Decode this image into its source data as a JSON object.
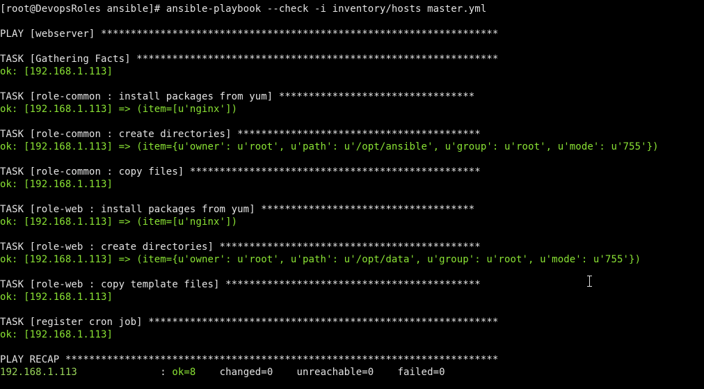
{
  "prompt": "[root@DevopsRoles ansible]# ",
  "command": "ansible-playbook --check -i inventory/hosts master.yml",
  "blank": "",
  "play_header": "PLAY [webserver] *******************************************************************",
  "tasks": [
    {
      "header": "TASK [Gathering Facts] *************************************************************",
      "result": "ok: [192.168.1.113]"
    },
    {
      "header": "TASK [role-common : install packages from yum] *********************************",
      "result": "ok: [192.168.1.113] => (item=[u'nginx'])"
    },
    {
      "header": "TASK [role-common : create directories] *****************************************",
      "result": "ok: [192.168.1.113] => (item={u'owner': u'root', u'path': u'/opt/ansible', u'group': u'root', u'mode': u'755'})"
    },
    {
      "header": "TASK [role-common : copy files] *************************************************",
      "result": "ok: [192.168.1.113]"
    },
    {
      "header": "TASK [role-web : install packages from yum] ************************************",
      "result": "ok: [192.168.1.113] => (item=[u'nginx'])"
    },
    {
      "header": "TASK [role-web : create directories] ********************************************",
      "result": "ok: [192.168.1.113] => (item={u'owner': u'root', u'path': u'/opt/data', u'group': u'root', u'mode': u'755'})"
    },
    {
      "header": "TASK [role-web : copy template files] *******************************************",
      "result": "ok: [192.168.1.113]"
    },
    {
      "header": "TASK [register cron job] ***********************************************************",
      "result": "ok: [192.168.1.113]"
    }
  ],
  "recap": {
    "header": "PLAY RECAP *************************************************************************",
    "host": "192.168.1.113",
    "pad": "              : ",
    "ok": "ok=8",
    "rest": "    changed=0    unreachable=0    failed=0"
  }
}
